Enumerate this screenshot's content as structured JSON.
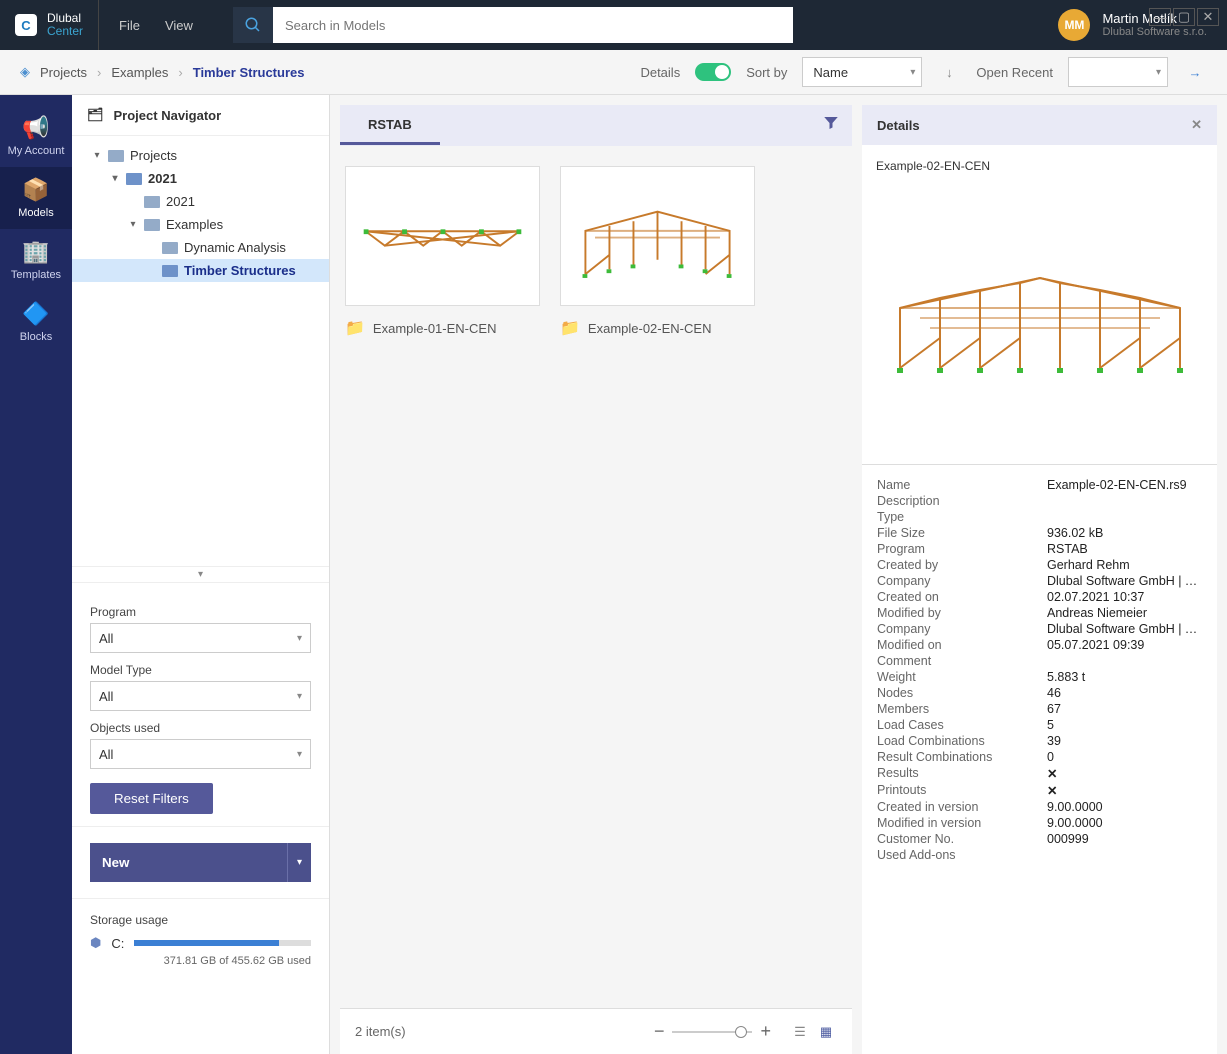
{
  "app": {
    "title_line1": "Dlubal",
    "title_line2": "Center",
    "menu": [
      "File",
      "View"
    ],
    "search_placeholder": "Search in Models"
  },
  "user": {
    "initials": "MM",
    "name": "Martin Motlík",
    "company": "Dlubal Software s.r.o."
  },
  "breadcrumbs": [
    "Projects",
    "Examples",
    "Timber Structures"
  ],
  "toolbar": {
    "details_label": "Details",
    "sort_label": "Sort by",
    "sort_value": "Name",
    "recent_label": "Open Recent"
  },
  "rail": [
    {
      "icon": "📢",
      "label": "My Account"
    },
    {
      "icon": "📦",
      "label": "Models"
    },
    {
      "icon": "🏢",
      "label": "Templates"
    },
    {
      "icon": "🔷",
      "label": "Blocks"
    }
  ],
  "nav": {
    "title": "Project Navigator",
    "tree": [
      {
        "label": "Projects",
        "indent": 1,
        "expand": true
      },
      {
        "label": "2021",
        "indent": 2,
        "expand": true,
        "bold": true
      },
      {
        "label": "2021",
        "indent": 3
      },
      {
        "label": "Examples",
        "indent": 3,
        "expand": true
      },
      {
        "label": "Dynamic Analysis",
        "indent": 4
      },
      {
        "label": "Timber Structures",
        "indent": 4,
        "active": true
      }
    ],
    "filters": {
      "program_label": "Program",
      "program_value": "All",
      "model_type_label": "Model Type",
      "model_type_value": "All",
      "objects_label": "Objects used",
      "objects_value": "All",
      "reset_label": "Reset Filters"
    },
    "new_label": "New",
    "storage": {
      "title": "Storage usage",
      "drive": "C:",
      "text": "371.81 GB of 455.62 GB used"
    }
  },
  "models": {
    "tab": "RSTAB",
    "items": [
      {
        "name": "Example-01-EN-CEN"
      },
      {
        "name": "Example-02-EN-CEN"
      }
    ],
    "count_text": "2 item(s)"
  },
  "details": {
    "title": "Details",
    "model_name": "Example-02-EN-CEN",
    "rows": [
      {
        "k": "Name",
        "v": "Example-02-EN-CEN.rs9"
      },
      {
        "k": "Description",
        "v": ""
      },
      {
        "k": "Type",
        "v": ""
      },
      {
        "k": "File Size",
        "v": "936.02 kB"
      },
      {
        "k": "Program",
        "v": "RSTAB"
      },
      {
        "k": "Created by",
        "v": "Gerhard Rehm"
      },
      {
        "k": "Company",
        "v": "Dlubal Software GmbH | Tief…"
      },
      {
        "k": "Created on",
        "v": "02.07.2021 10:37"
      },
      {
        "k": "Modified by",
        "v": "Andreas Niemeier"
      },
      {
        "k": "Company",
        "v": "Dlubal Software GmbH | Tief…"
      },
      {
        "k": "Modified on",
        "v": "05.07.2021 09:39"
      },
      {
        "k": "Comment",
        "v": ""
      },
      {
        "k": "Weight",
        "v": "5.883 t"
      },
      {
        "k": "Nodes",
        "v": "46"
      },
      {
        "k": "Members",
        "v": "67"
      },
      {
        "k": "Load Cases",
        "v": "5"
      },
      {
        "k": "Load Combinations",
        "v": "39"
      },
      {
        "k": "Result Combinations",
        "v": "0"
      },
      {
        "k": "Results",
        "v": "X",
        "red": true
      },
      {
        "k": "Printouts",
        "v": "X",
        "red": true
      },
      {
        "k": "Created in version",
        "v": "9.00.0000"
      },
      {
        "k": "Modified in version",
        "v": "9.00.0000"
      },
      {
        "k": "Customer No.",
        "v": "000999"
      },
      {
        "k": "Used Add-ons",
        "v": ""
      }
    ]
  }
}
